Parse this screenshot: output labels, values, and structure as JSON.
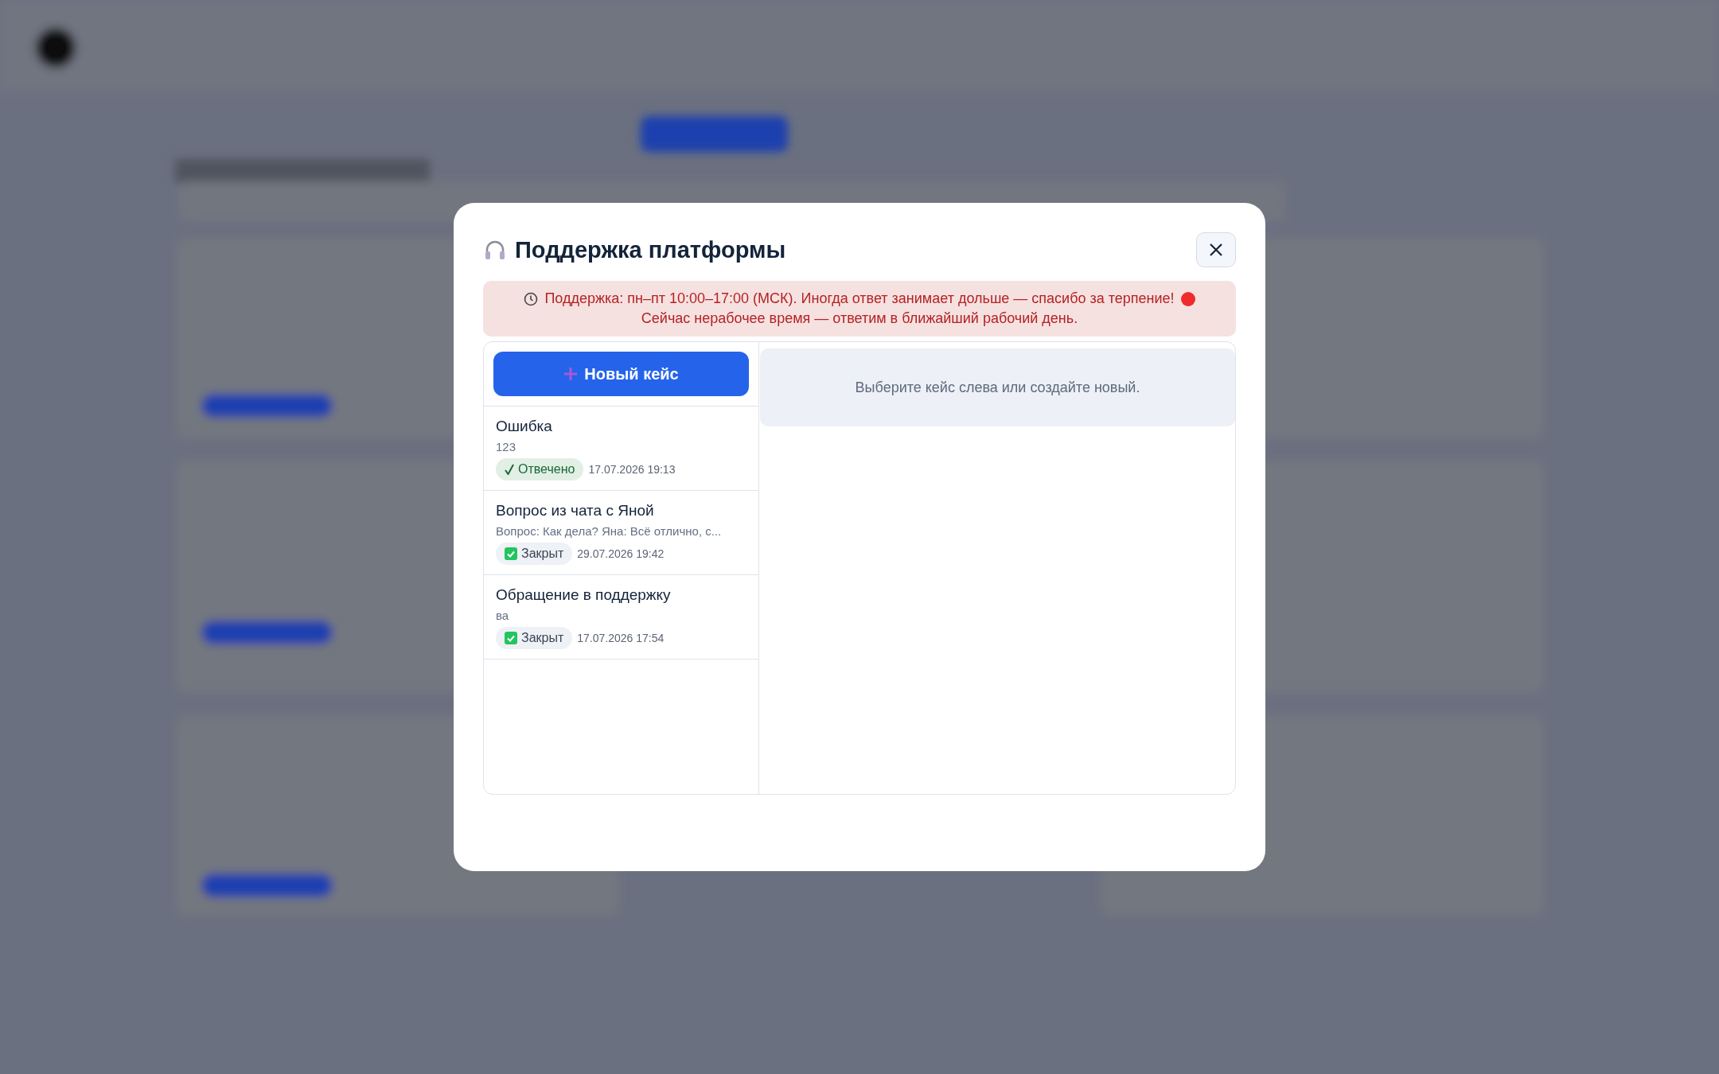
{
  "dialog": {
    "title": "Поддержка платформы",
    "notice": {
      "lines": [
        "Поддержка: пн–пт 10:00–17:00 (МСК). Иногда ответ занимает дольше — спасибо за терпение!",
        "Сейчас нерабочее время — ответим в ближайший рабочий день."
      ]
    },
    "new_case_button": "Новый кейс",
    "cases": [
      {
        "title": "Ошибка",
        "preview": "123",
        "status": {
          "kind": "answered",
          "label": "Отвечено"
        },
        "date": "17.07.2026 19:13"
      },
      {
        "title": "Вопрос из чата с Яной",
        "preview": "Вопрос: Как дела? Яна: Всё отлично, с...",
        "status": {
          "kind": "closed",
          "label": "Закрыт"
        },
        "date": "29.07.2026 19:42"
      },
      {
        "title": "Обращение в поддержку",
        "preview": "ва",
        "status": {
          "kind": "closed",
          "label": "Закрыт"
        },
        "date": "17.07.2026 17:54"
      }
    ],
    "empty_state": "Выберите кейс слева или создайте новый."
  }
}
